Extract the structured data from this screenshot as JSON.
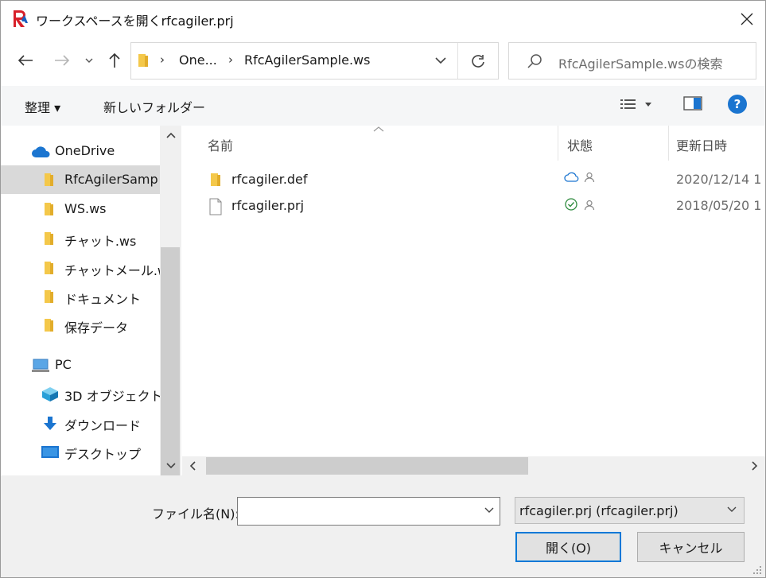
{
  "window": {
    "title": "ワークスペースを開くrfcagiler.prj"
  },
  "address": {
    "crumbs": [
      "One...",
      "RfcAgilerSample.ws"
    ],
    "search_placeholder": "RfcAgilerSample.wsの検索"
  },
  "toolbar": {
    "organize": "整理 ▾",
    "new_folder": "新しいフォルダー"
  },
  "nav": {
    "items": [
      {
        "label": "OneDrive",
        "icon": "cloud-icon"
      },
      {
        "label": "RfcAgilerSamp",
        "icon": "folder-icon",
        "selected": true
      },
      {
        "label": "WS.ws",
        "icon": "folder-icon"
      },
      {
        "label": "チャット.ws",
        "icon": "folder-icon"
      },
      {
        "label": "チャットメール.ws",
        "icon": "folder-icon"
      },
      {
        "label": "ドキュメント",
        "icon": "folder-icon"
      },
      {
        "label": "保存データ",
        "icon": "folder-icon"
      },
      {
        "label": "PC",
        "icon": "pc-icon"
      },
      {
        "label": "3D オブジェクト",
        "icon": "3d-objects-icon"
      },
      {
        "label": "ダウンロード",
        "icon": "download-icon"
      },
      {
        "label": "デスクトップ",
        "icon": "desktop-icon"
      }
    ]
  },
  "filelist": {
    "columns": [
      "名前",
      "状態",
      "更新日時"
    ],
    "rows": [
      {
        "name": "rfcagiler.def",
        "type": "folder",
        "status": "cloud",
        "date": "2020/12/14 1"
      },
      {
        "name": "rfcagiler.prj",
        "type": "file",
        "status": "synced",
        "date": "2018/05/20 1"
      }
    ]
  },
  "bottom": {
    "filename_label": "ファイル名(N):",
    "filename_value": "",
    "filter": "rfcagiler.prj (rfcagiler.prj)",
    "open": "開く(O)",
    "cancel": "キャンセル"
  },
  "colors": {
    "accent": "#0078d7",
    "folder": "#f4c84a",
    "synced": "#2e8b3e",
    "cloud": "#1b75d0"
  }
}
